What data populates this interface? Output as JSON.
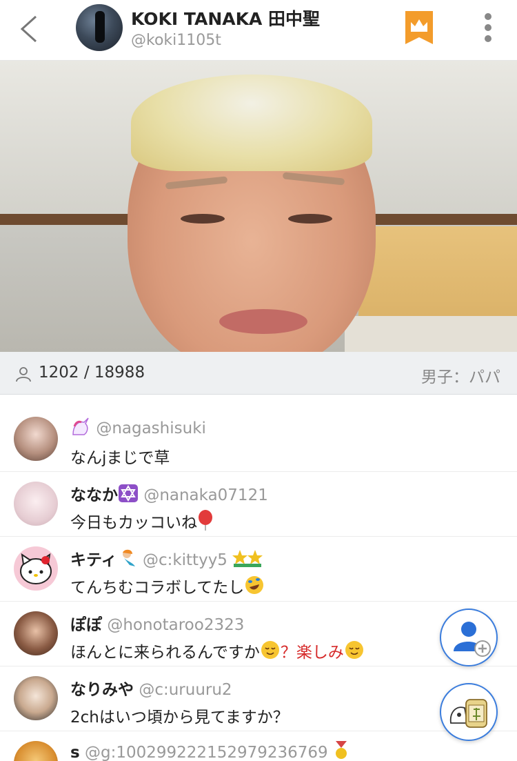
{
  "header": {
    "title": "KOKI TANAKA 田中聖",
    "handle": "@koki1105t",
    "accent_color": "#f39c2b"
  },
  "stats": {
    "viewers": "1202 / 18988",
    "tag": "男子：パパ"
  },
  "comments": [
    {
      "nickname": "",
      "badge": "unicorn",
      "user_id": "@nagashisuki",
      "message": "なんjまじで草"
    },
    {
      "nickname": "ななか",
      "badge": "star-of-david",
      "user_id": "@nanaka07121",
      "message": "今日もカッコいね",
      "emoji": "balloon"
    },
    {
      "nickname": "キティ",
      "badge": "mermaid",
      "user_id": "@c:kittyy5",
      "extra_badge": "double-star",
      "message": "てんちむコラボしてたし",
      "emoji": "rofl"
    },
    {
      "nickname": "ぽぽ",
      "user_id": "@honotaroo2323",
      "message_parts": [
        "ほんとに来られるんですか",
        "？楽しみ"
      ],
      "emoji": "relieved"
    },
    {
      "nickname": "なりみや",
      "user_id": "@c:uruuru2",
      "message": "2chはいつ頃から見てますか？"
    },
    {
      "nickname": "s",
      "user_id": "@g:1002992221529792367​69",
      "extra_badge": "medal"
    }
  ],
  "actions": {
    "follow_icon": "add-user-icon",
    "gift_icon": "tea-gift-icon"
  }
}
